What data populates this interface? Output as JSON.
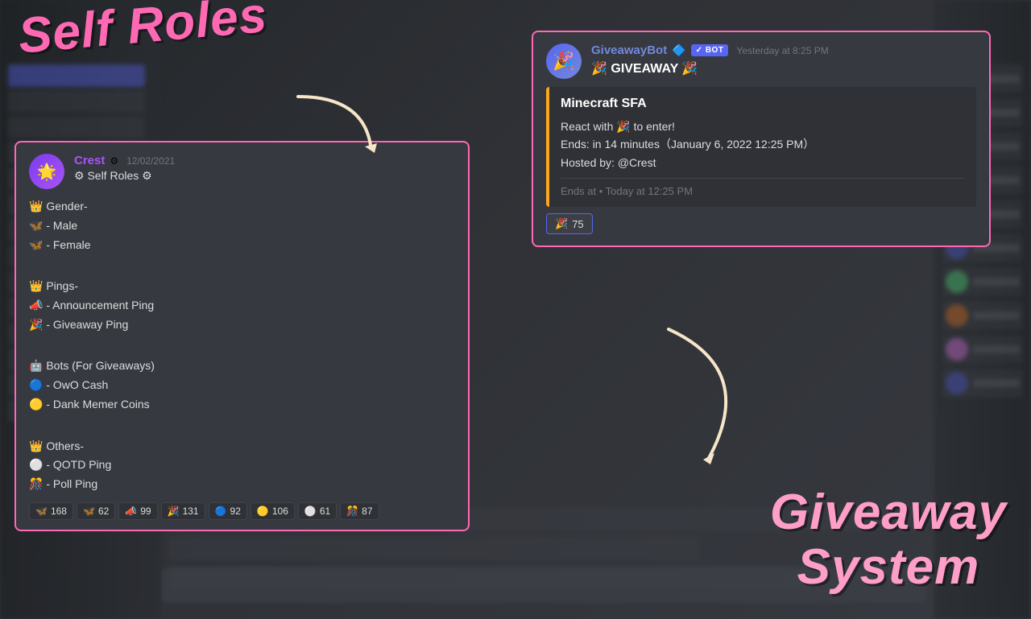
{
  "background": {
    "color": "#2f3136"
  },
  "self_roles_title": "Self Roles",
  "giveaway_system_title": "Giveaway\nSystem",
  "self_roles_card": {
    "username": "Crest",
    "timestamp": "12/02/2021",
    "title": "⚙ Self Roles ⚙",
    "sections": [
      "👑 Gender-",
      "🦋 - Male",
      "🦋 - Female",
      "",
      "👑 Pings-",
      "📣 - Announcement Ping",
      "🎉 - Giveaway Ping",
      "",
      "🤖 Bots (For Giveaways)",
      "🔵 - OwO Cash",
      "🟡 - Dank Memer Coins",
      "",
      "👑 Others-",
      "⚪ - QOTD Ping",
      "🎊 - Poll Ping"
    ],
    "reactions": [
      {
        "emoji": "🦋",
        "count": "168"
      },
      {
        "emoji": "🦋",
        "count": "62"
      },
      {
        "emoji": "📣",
        "count": "99"
      },
      {
        "emoji": "🎉",
        "count": "131"
      },
      {
        "emoji": "🔵",
        "count": "92"
      },
      {
        "emoji": "🟡",
        "count": "106"
      },
      {
        "emoji": "⚪",
        "count": "61"
      },
      {
        "emoji": "🎊",
        "count": "87"
      }
    ]
  },
  "giveaway_card": {
    "username": "GiveawayBot",
    "bot_badge": "✓ BOT",
    "timestamp": "Yesterday at 8:25 PM",
    "title": "🎉 GIVEAWAY 🎉",
    "embed": {
      "prize": "Minecraft SFA",
      "line1": "React with 🎉 to enter!",
      "line2": "Ends:  in 14 minutes（January 6, 2022 12:25 PM）",
      "line3": "Hosted by: @Crest",
      "ends_at": "Ends at • Today at 12:25 PM"
    },
    "reaction": {
      "emoji": "🎉",
      "count": "75"
    }
  }
}
